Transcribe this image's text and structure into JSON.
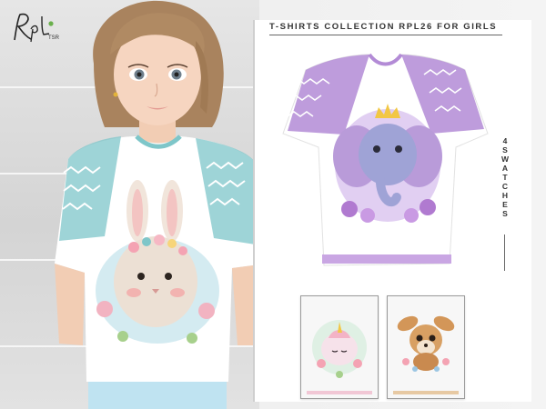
{
  "collection_title": "T-SHIRTS COLLECTION RPL26 FOR GIRLS",
  "swatch_label_chars": [
    "4",
    "S",
    "W",
    "A",
    "T",
    "C",
    "H",
    "E",
    "S"
  ],
  "logo": {
    "text": "RpL",
    "sub_text": "TSR"
  },
  "colors": {
    "background": "#e9e9e9",
    "frame": "#ffffff",
    "main_shirt_trim": "#b38bd6",
    "model_shirt_trim": "#7ec6c9",
    "hair": "#a9835e"
  },
  "images": {
    "model": "girl-wearing-bunny-tshirt",
    "main_swatch": "elephant-with-crown-tshirt",
    "swatch_2": "unicorn-tshirt",
    "swatch_3": "fawn-tshirt"
  }
}
